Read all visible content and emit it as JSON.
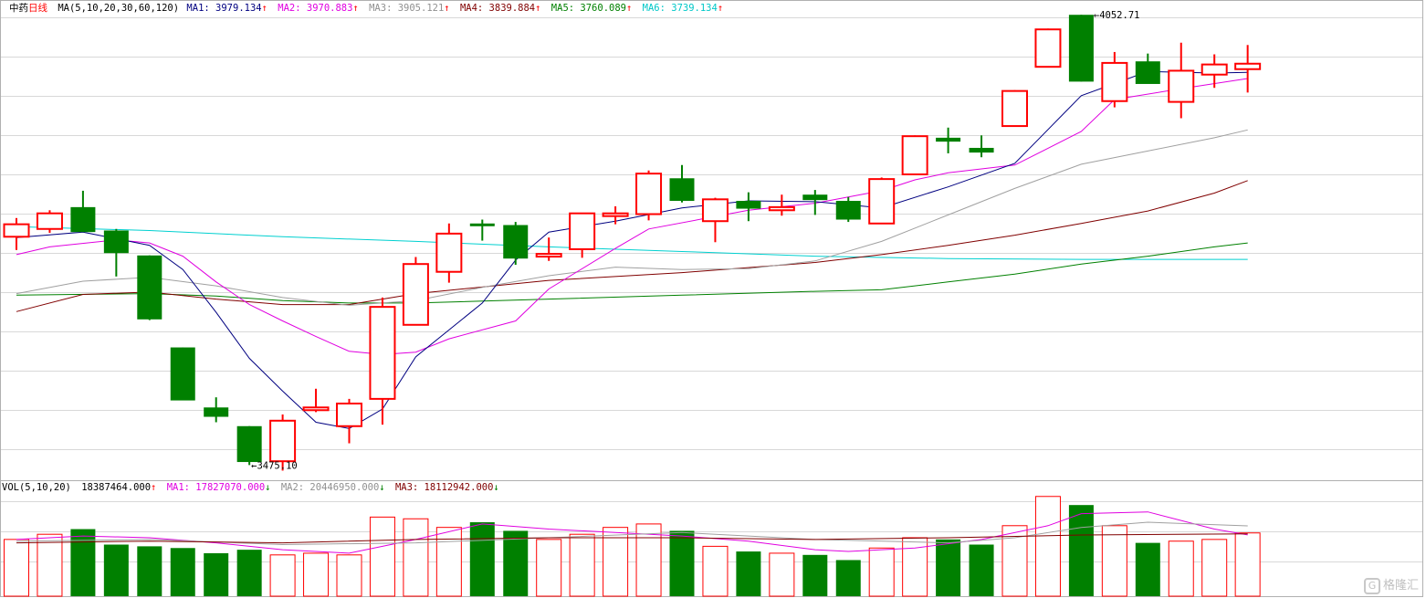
{
  "colors": {
    "up": "#ff0000",
    "down": "#008000",
    "grid": "#d8d8d8",
    "ma1": "#000080",
    "ma2": "#e000e0",
    "ma3": "#a0a0a0",
    "ma4": "#800000",
    "ma5": "#008000",
    "ma6": "#00d0d0",
    "vol_ma1": "#e000e0",
    "vol_ma2": "#a0a0a0",
    "vol_ma3": "#800000"
  },
  "legend": {
    "title": "中药",
    "period": "日线",
    "ma_group": "MA(5,10,20,30,60,120)",
    "ma1": "MA1: 3979.134",
    "ma2": "MA2: 3970.883",
    "ma3": "MA3: 3905.121",
    "ma4": "MA4: 3839.884",
    "ma5": "MA5: 3760.089",
    "ma6": "MA6: 3739.134",
    "arrow_up": "↑",
    "arrow_down": "↓"
  },
  "vol_legend": {
    "group": "VOL(5,10,20)",
    "value": "18387464.000",
    "ma1": "MA1: 17827070.000",
    "ma2": "MA2: 20446950.000",
    "ma3": "MA3: 18112942.000"
  },
  "watermark": "格隆汇",
  "chart_data": {
    "type": "candlestick",
    "price_range": [
      3465,
      4060
    ],
    "volume_range": [
      0,
      30000000
    ],
    "annotations": [
      {
        "label": "4052.71",
        "index": 32,
        "value": 4052.71
      },
      {
        "label": "3475.10",
        "index": 7,
        "value": 3475.1
      }
    ],
    "candles": [
      {
        "o": 3768,
        "h": 3792,
        "l": 3751,
        "c": 3784,
        "v": 16500000
      },
      {
        "o": 3778,
        "h": 3802,
        "l": 3773,
        "c": 3798,
        "v": 18000000
      },
      {
        "o": 3806,
        "h": 3827,
        "l": 3780,
        "c": 3774,
        "v": 19500000
      },
      {
        "o": 3776,
        "h": 3778,
        "l": 3717,
        "c": 3747,
        "v": 15000000
      },
      {
        "o": 3744,
        "h": 3744,
        "l": 3661,
        "c": 3662,
        "v": 14500000
      },
      {
        "o": 3626,
        "h": 3626,
        "l": 3559,
        "c": 3558,
        "v": 14000000
      },
      {
        "o": 3549,
        "h": 3562,
        "l": 3530,
        "c": 3537,
        "v": 12500000
      },
      {
        "o": 3525,
        "h": 3525,
        "l": 3475.1,
        "c": 3479,
        "v": 13500000
      },
      {
        "o": 3480,
        "h": 3540,
        "l": 3468,
        "c": 3532,
        "v": 12000000
      },
      {
        "o": 3547,
        "h": 3573,
        "l": 3543,
        "c": 3549,
        "v": 12500000
      },
      {
        "o": 3525,
        "h": 3560,
        "l": 3503,
        "c": 3554,
        "v": 12000000
      },
      {
        "o": 3560,
        "h": 3690,
        "l": 3527,
        "c": 3678,
        "v": 23000000
      },
      {
        "o": 3655,
        "h": 3742,
        "l": 3655,
        "c": 3733,
        "v": 22500000
      },
      {
        "o": 3723,
        "h": 3785,
        "l": 3709,
        "c": 3772,
        "v": 20000000
      },
      {
        "o": 3785,
        "h": 3790,
        "l": 3763,
        "c": 3782,
        "v": 21500000
      },
      {
        "o": 3783,
        "h": 3787,
        "l": 3732,
        "c": 3740,
        "v": 19000000
      },
      {
        "o": 3745,
        "h": 3767,
        "l": 3737,
        "c": 3746,
        "v": 16500000
      },
      {
        "o": 3752,
        "h": 3798,
        "l": 3741,
        "c": 3798,
        "v": 18000000
      },
      {
        "o": 3795,
        "h": 3807,
        "l": 3784,
        "c": 3798,
        "v": 20000000
      },
      {
        "o": 3797,
        "h": 3853,
        "l": 3789,
        "c": 3849,
        "v": 21000000
      },
      {
        "o": 3843,
        "h": 3860,
        "l": 3812,
        "c": 3814,
        "v": 19000000
      },
      {
        "o": 3788,
        "h": 3818,
        "l": 3761,
        "c": 3816,
        "v": 14500000
      },
      {
        "o": 3814,
        "h": 3825,
        "l": 3788,
        "c": 3804,
        "v": 13000000
      },
      {
        "o": 3802,
        "h": 3822,
        "l": 3795,
        "c": 3806,
        "v": 12500000
      },
      {
        "o": 3822,
        "h": 3828,
        "l": 3796,
        "c": 3815,
        "v": 12000000
      },
      {
        "o": 3814,
        "h": 3819,
        "l": 3787,
        "c": 3790,
        "v": 10500000
      },
      {
        "o": 3785,
        "h": 3844,
        "l": 3785,
        "c": 3842,
        "v": 14000000
      },
      {
        "o": 3848,
        "h": 3898,
        "l": 3848,
        "c": 3897,
        "v": 17000000
      },
      {
        "o": 3895,
        "h": 3908,
        "l": 3875,
        "c": 3890,
        "v": 16500000
      },
      {
        "o": 3882,
        "h": 3898,
        "l": 3870,
        "c": 3876,
        "v": 15000000
      },
      {
        "o": 3910,
        "h": 3956,
        "l": 3910,
        "c": 3955,
        "v": 20500000
      },
      {
        "o": 3986,
        "h": 4035,
        "l": 3986,
        "c": 4034,
        "v": 29000000
      },
      {
        "o": 4052.71,
        "h": 4052.71,
        "l": 3967,
        "c": 3967,
        "v": 26500000
      },
      {
        "o": 3942,
        "h": 4005,
        "l": 3934,
        "c": 3991,
        "v": 20500000
      },
      {
        "o": 3993,
        "h": 4003,
        "l": 3968,
        "c": 3964,
        "v": 15500000
      },
      {
        "o": 3941,
        "h": 4017,
        "l": 3920,
        "c": 3981,
        "v": 16000000
      },
      {
        "o": 3976,
        "h": 4002,
        "l": 3959,
        "c": 3989,
        "v": 16500000
      },
      {
        "o": 3983,
        "h": 4014,
        "l": 3953,
        "c": 3990,
        "v": 18387464
      }
    ],
    "series": [
      {
        "name": "MA1",
        "points": [
          [
            0,
            3767
          ],
          [
            2,
            3774
          ],
          [
            4,
            3757
          ],
          [
            5,
            3726
          ],
          [
            6,
            3671
          ],
          [
            7,
            3612
          ],
          [
            8,
            3570
          ],
          [
            9,
            3530
          ],
          [
            10,
            3522
          ],
          [
            11,
            3547
          ],
          [
            12,
            3614
          ],
          [
            14,
            3683
          ],
          [
            15,
            3738
          ],
          [
            16,
            3774
          ],
          [
            18,
            3788
          ],
          [
            20,
            3805
          ],
          [
            22,
            3814
          ],
          [
            24,
            3813
          ],
          [
            26,
            3805
          ],
          [
            28,
            3832
          ],
          [
            30,
            3862
          ],
          [
            32,
            3949
          ],
          [
            34,
            3980
          ],
          [
            36,
            3978
          ],
          [
            37,
            3979
          ]
        ]
      },
      {
        "name": "MA2",
        "points": [
          [
            0,
            3745
          ],
          [
            1,
            3755
          ],
          [
            3,
            3764
          ],
          [
            4,
            3760
          ],
          [
            5,
            3743
          ],
          [
            6,
            3710
          ],
          [
            7,
            3681
          ],
          [
            8,
            3660
          ],
          [
            9,
            3640
          ],
          [
            10,
            3621
          ],
          [
            11,
            3617
          ],
          [
            12,
            3620
          ],
          [
            13,
            3637
          ],
          [
            15,
            3660
          ],
          [
            16,
            3701
          ],
          [
            18,
            3753
          ],
          [
            19,
            3778
          ],
          [
            22,
            3802
          ],
          [
            24,
            3811
          ],
          [
            26,
            3827
          ],
          [
            27,
            3841
          ],
          [
            28,
            3850
          ],
          [
            30,
            3860
          ],
          [
            32,
            3903
          ],
          [
            33,
            3944
          ],
          [
            35,
            3958
          ],
          [
            37,
            3971
          ]
        ]
      },
      {
        "name": "MA3",
        "points": [
          [
            0,
            3695
          ],
          [
            2,
            3711
          ],
          [
            4,
            3716
          ],
          [
            6,
            3705
          ],
          [
            8,
            3690
          ],
          [
            10,
            3680
          ],
          [
            12,
            3686
          ],
          [
            14,
            3703
          ],
          [
            16,
            3718
          ],
          [
            18,
            3729
          ],
          [
            20,
            3726
          ],
          [
            22,
            3727
          ],
          [
            24,
            3737
          ],
          [
            26,
            3762
          ],
          [
            28,
            3796
          ],
          [
            30,
            3830
          ],
          [
            32,
            3861
          ],
          [
            34,
            3878
          ],
          [
            36,
            3895
          ],
          [
            37,
            3905
          ]
        ]
      },
      {
        "name": "MA4",
        "points": [
          [
            0,
            3672
          ],
          [
            2,
            3694
          ],
          [
            4,
            3697
          ],
          [
            6,
            3688
          ],
          [
            8,
            3681
          ],
          [
            10,
            3681
          ],
          [
            12,
            3695
          ],
          [
            16,
            3712
          ],
          [
            20,
            3722
          ],
          [
            24,
            3735
          ],
          [
            26,
            3745
          ],
          [
            28,
            3757
          ],
          [
            30,
            3770
          ],
          [
            32,
            3785
          ],
          [
            34,
            3801
          ],
          [
            36,
            3824
          ],
          [
            37,
            3840
          ]
        ]
      },
      {
        "name": "MA5",
        "points": [
          [
            0,
            3693
          ],
          [
            4,
            3695
          ],
          [
            6,
            3692
          ],
          [
            8,
            3686
          ],
          [
            10,
            3683
          ],
          [
            12,
            3683
          ],
          [
            16,
            3688
          ],
          [
            20,
            3693
          ],
          [
            24,
            3698
          ],
          [
            26,
            3700
          ],
          [
            28,
            3710
          ],
          [
            30,
            3720
          ],
          [
            32,
            3733
          ],
          [
            34,
            3743
          ],
          [
            36,
            3755
          ],
          [
            37,
            3760
          ]
        ]
      },
      {
        "name": "MA6",
        "points": [
          [
            0,
            3781
          ],
          [
            4,
            3776
          ],
          [
            8,
            3768
          ],
          [
            12,
            3762
          ],
          [
            16,
            3755
          ],
          [
            20,
            3749
          ],
          [
            24,
            3743
          ],
          [
            28,
            3740
          ],
          [
            32,
            3739
          ],
          [
            37,
            3739
          ]
        ]
      }
    ],
    "volume_ma": [
      {
        "name": "MA1",
        "points": [
          [
            0,
            16500000
          ],
          [
            2,
            17500000
          ],
          [
            4,
            17000000
          ],
          [
            6,
            15500000
          ],
          [
            8,
            13500000
          ],
          [
            10,
            12500000
          ],
          [
            12,
            16500000
          ],
          [
            14,
            21000000
          ],
          [
            16,
            19500000
          ],
          [
            18,
            18500000
          ],
          [
            20,
            17500000
          ],
          [
            22,
            16000000
          ],
          [
            24,
            13500000
          ],
          [
            25,
            13000000
          ],
          [
            27,
            14000000
          ],
          [
            29,
            16500000
          ],
          [
            31,
            20500000
          ],
          [
            32,
            24000000
          ],
          [
            34,
            24500000
          ],
          [
            36,
            19500000
          ],
          [
            37,
            17827070
          ]
        ]
      },
      {
        "name": "MA2",
        "points": [
          [
            0,
            16000000
          ],
          [
            4,
            16500000
          ],
          [
            8,
            15000000
          ],
          [
            12,
            15500000
          ],
          [
            16,
            17000000
          ],
          [
            20,
            18500000
          ],
          [
            24,
            16500000
          ],
          [
            28,
            15500000
          ],
          [
            30,
            17000000
          ],
          [
            32,
            20000000
          ],
          [
            34,
            21500000
          ],
          [
            37,
            20446950
          ]
        ]
      },
      {
        "name": "MA3",
        "points": [
          [
            0,
            15500000
          ],
          [
            4,
            16000000
          ],
          [
            8,
            15500000
          ],
          [
            12,
            16500000
          ],
          [
            16,
            17000000
          ],
          [
            20,
            17000000
          ],
          [
            24,
            16500000
          ],
          [
            28,
            17000000
          ],
          [
            32,
            17800000
          ],
          [
            37,
            18112942
          ]
        ]
      }
    ]
  }
}
